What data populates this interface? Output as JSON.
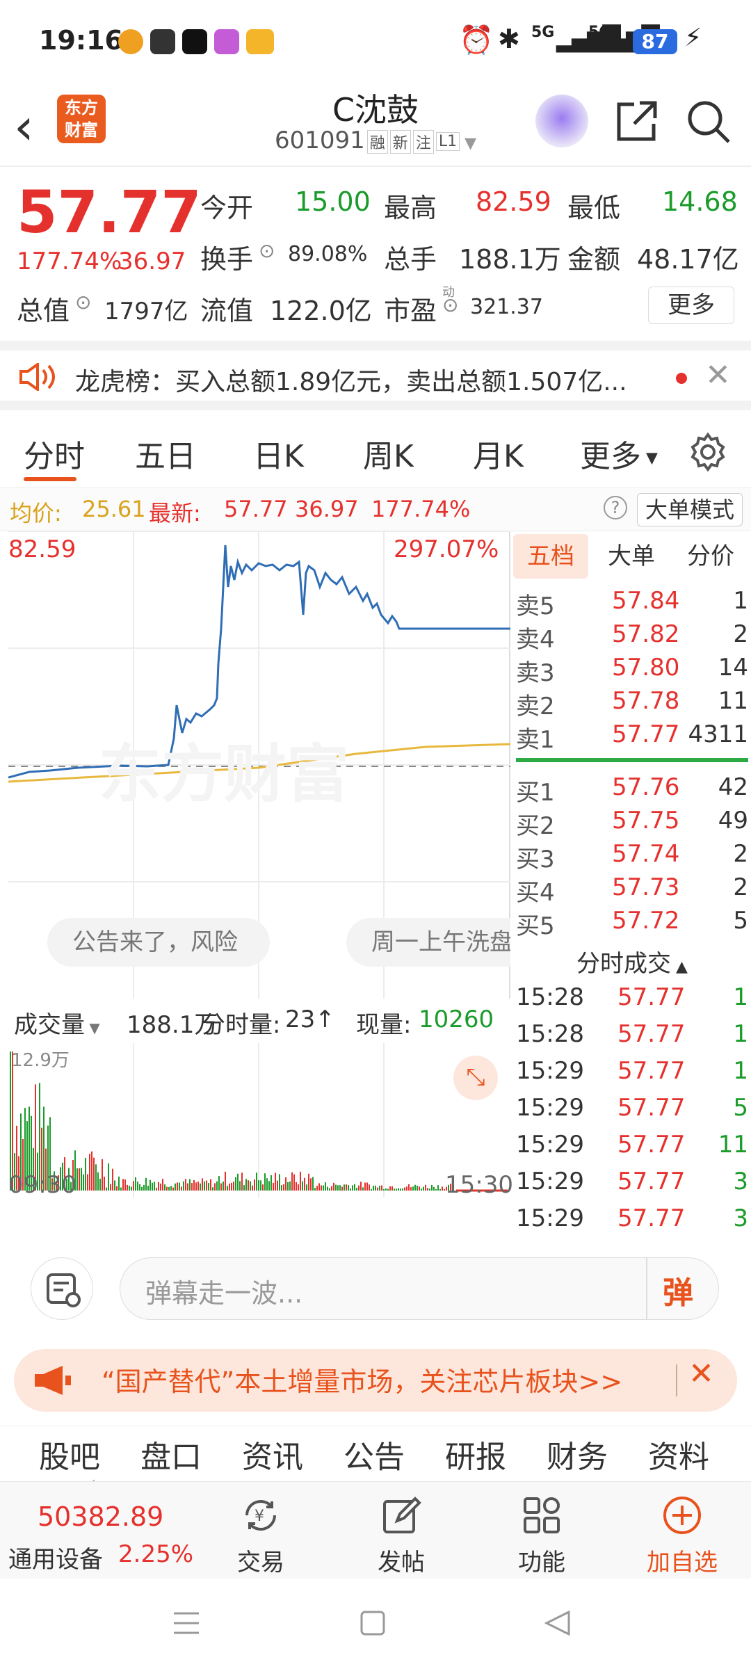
{
  "status": {
    "time": "19:16",
    "battery": "87",
    "net1": "5G",
    "net2": "5G"
  },
  "nav": {
    "name": "C沈鼓",
    "code": "601091",
    "badges": [
      "融",
      "新",
      "注",
      "L1"
    ],
    "logo_top": "东方",
    "logo_bottom": "财富"
  },
  "quote": {
    "price": "57.77",
    "pct": "177.74%",
    "chg": "36.97",
    "open_l": "今开",
    "open": "15.00",
    "high_l": "最高",
    "high": "82.59",
    "low_l": "最低",
    "low": "14.68",
    "turn_l": "换手",
    "turn": "89.08%",
    "vol_l": "总手",
    "vol": "188.1万",
    "amt_l": "金额",
    "amt": "48.17亿",
    "mcap_l": "总值",
    "mcap": "1797亿",
    "float_l": "流值",
    "float": "122.0亿",
    "pe_l": "市盈",
    "pe_sup": "动",
    "pe": "321.37",
    "more": "更多"
  },
  "lhb": {
    "text": "龙虎榜：买入总额1.89亿元，卖出总额1.507亿..."
  },
  "tabs": [
    "分时",
    "五日",
    "日K",
    "周K",
    "月K",
    "更多"
  ],
  "avg": {
    "label": "均价:",
    "value": "25.61",
    "latest_l": "最新:",
    "latest": "57.77",
    "chg": "36.97",
    "pct": "177.74%",
    "mode": "大单模式"
  },
  "chart": {
    "top_left": "82.59",
    "top_right": "297.07%",
    "bubble1": "公告来了，风险",
    "bubble2": "周一上午洗盘",
    "watermark": "东方财富"
  },
  "vol_head": {
    "label": "成交量",
    "total": "188.1万",
    "tick_l": "分时量:",
    "tick": "23",
    "cur_l": "现量:",
    "cur": "10260",
    "max": "12.9万",
    "t_start": "09:30",
    "t_end": "15:30"
  },
  "depth": {
    "tabs": [
      "五档",
      "大单",
      "分价"
    ],
    "asks": [
      [
        "卖5",
        "57.84",
        "1"
      ],
      [
        "卖4",
        "57.82",
        "2"
      ],
      [
        "卖3",
        "57.80",
        "14"
      ],
      [
        "卖2",
        "57.78",
        "11"
      ],
      [
        "卖1",
        "57.77",
        "4311"
      ]
    ],
    "bids": [
      [
        "买1",
        "57.76",
        "42"
      ],
      [
        "买2",
        "57.75",
        "49"
      ],
      [
        "买3",
        "57.74",
        "2"
      ],
      [
        "买4",
        "57.73",
        "2"
      ],
      [
        "买5",
        "57.72",
        "5"
      ]
    ],
    "trade_title": "分时成交",
    "trades": [
      [
        "15:28",
        "57.77",
        "1"
      ],
      [
        "15:28",
        "57.77",
        "1"
      ],
      [
        "15:29",
        "57.77",
        "1"
      ],
      [
        "15:29",
        "57.77",
        "5"
      ],
      [
        "15:29",
        "57.77",
        "11"
      ],
      [
        "15:29",
        "57.77",
        "3"
      ],
      [
        "15:29",
        "57.77",
        "3"
      ]
    ]
  },
  "chat": {
    "placeholder": "弹幕走一波...",
    "btn": "弹"
  },
  "ad": {
    "text": "“国产替代”本土增量市场，关注芯片板块>>"
  },
  "subtabs": [
    "股吧",
    "盘口",
    "资讯",
    "公告",
    "研报",
    "财务",
    "资料"
  ],
  "bottom": {
    "index": "50382.89",
    "sector": "通用设备",
    "sector_pct": "2.25%",
    "btns": [
      "交易",
      "发帖",
      "功能",
      "加自选"
    ]
  },
  "colors": {
    "up": "#e5312d",
    "down": "#1a9b2a",
    "accent": "#e8521d",
    "price_line": "#2f6db5",
    "avg_line": "#e8b83c"
  }
}
